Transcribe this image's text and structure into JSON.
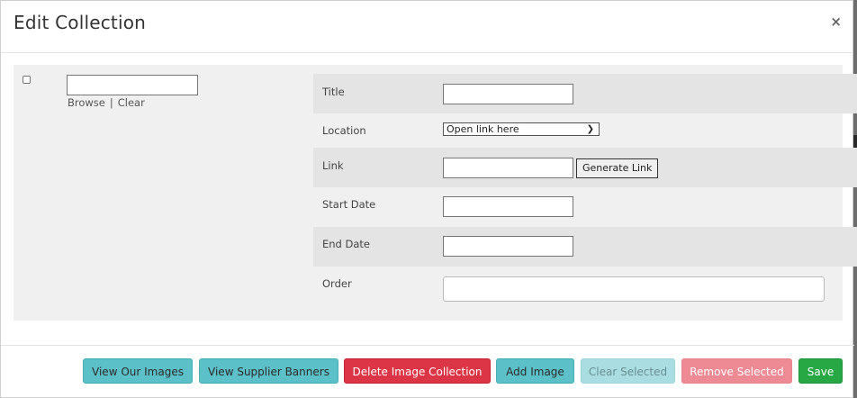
{
  "modal": {
    "title": "Edit Collection",
    "close_label": "×"
  },
  "image_row": {
    "browse_label": "Browse",
    "separator": "|",
    "clear_label": "Clear"
  },
  "form": {
    "title_label": "Title",
    "location_label": "Location",
    "location_value": "Open link here",
    "link_label": "Link",
    "generate_link_label": "Generate Link",
    "start_date_label": "Start Date",
    "end_date_label": "End Date",
    "order_label": "Order"
  },
  "footer": {
    "view_our_images": "View Our Images",
    "view_supplier_banners": "View Supplier Banners",
    "delete_image_collection": "Delete Image Collection",
    "add_image": "Add Image",
    "clear_selected": "Clear Selected",
    "remove_selected": "Remove Selected",
    "save": "Save"
  },
  "colors": {
    "info": "#5bc0c7",
    "danger": "#dc3545",
    "success": "#28a745"
  }
}
